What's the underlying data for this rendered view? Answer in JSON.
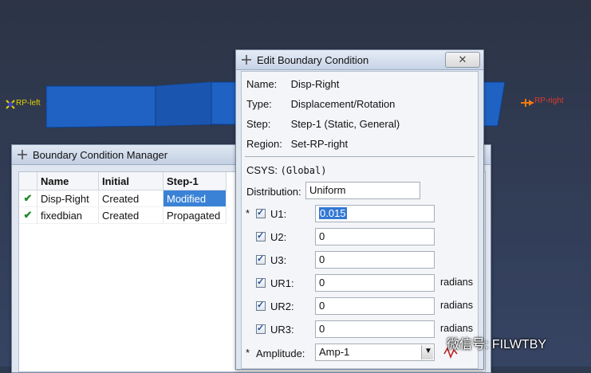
{
  "viewport": {
    "rp_left_label": "RP-left",
    "rp_right_label": "RP-right"
  },
  "manager": {
    "title": "Boundary Condition Manager",
    "columns": [
      "Name",
      "Initial",
      "Step-1"
    ],
    "rows": [
      {
        "name": "Disp-Right",
        "initial": "Created",
        "step1": "Modified"
      },
      {
        "name": "fixedbian",
        "initial": "Created",
        "step1": "Propagated"
      }
    ]
  },
  "edit": {
    "title": "Edit Boundary Condition",
    "name_label": "Name:",
    "name_value": "Disp-Right",
    "type_label": "Type:",
    "type_value": "Displacement/Rotation",
    "step_label": "Step:",
    "step_value": "Step-1 (Static, General)",
    "region_label": "Region:",
    "region_value": "Set-RP-right",
    "csys_label": "CSYS:",
    "csys_value": "(Global)",
    "distribution_label": "Distribution:",
    "distribution_value": "Uniform",
    "required_mark": "*",
    "u1_label": "U1:",
    "u1_value": "0.015",
    "u2_label": "U2:",
    "u2_value": "0",
    "u3_label": "U3:",
    "u3_value": "0",
    "ur1_label": "UR1:",
    "ur1_value": "0",
    "ur2_label": "UR2:",
    "ur2_value": "0",
    "ur3_label": "UR3:",
    "ur3_value": "0",
    "radians": "radians",
    "amplitude_label": "Amplitude:",
    "amplitude_value": "Amp-1"
  },
  "watermark": "微信号: FILWTBY",
  "colors": {
    "part": "#1f62c4",
    "selection": "#3a82d6",
    "check": "#1f8a2a"
  }
}
